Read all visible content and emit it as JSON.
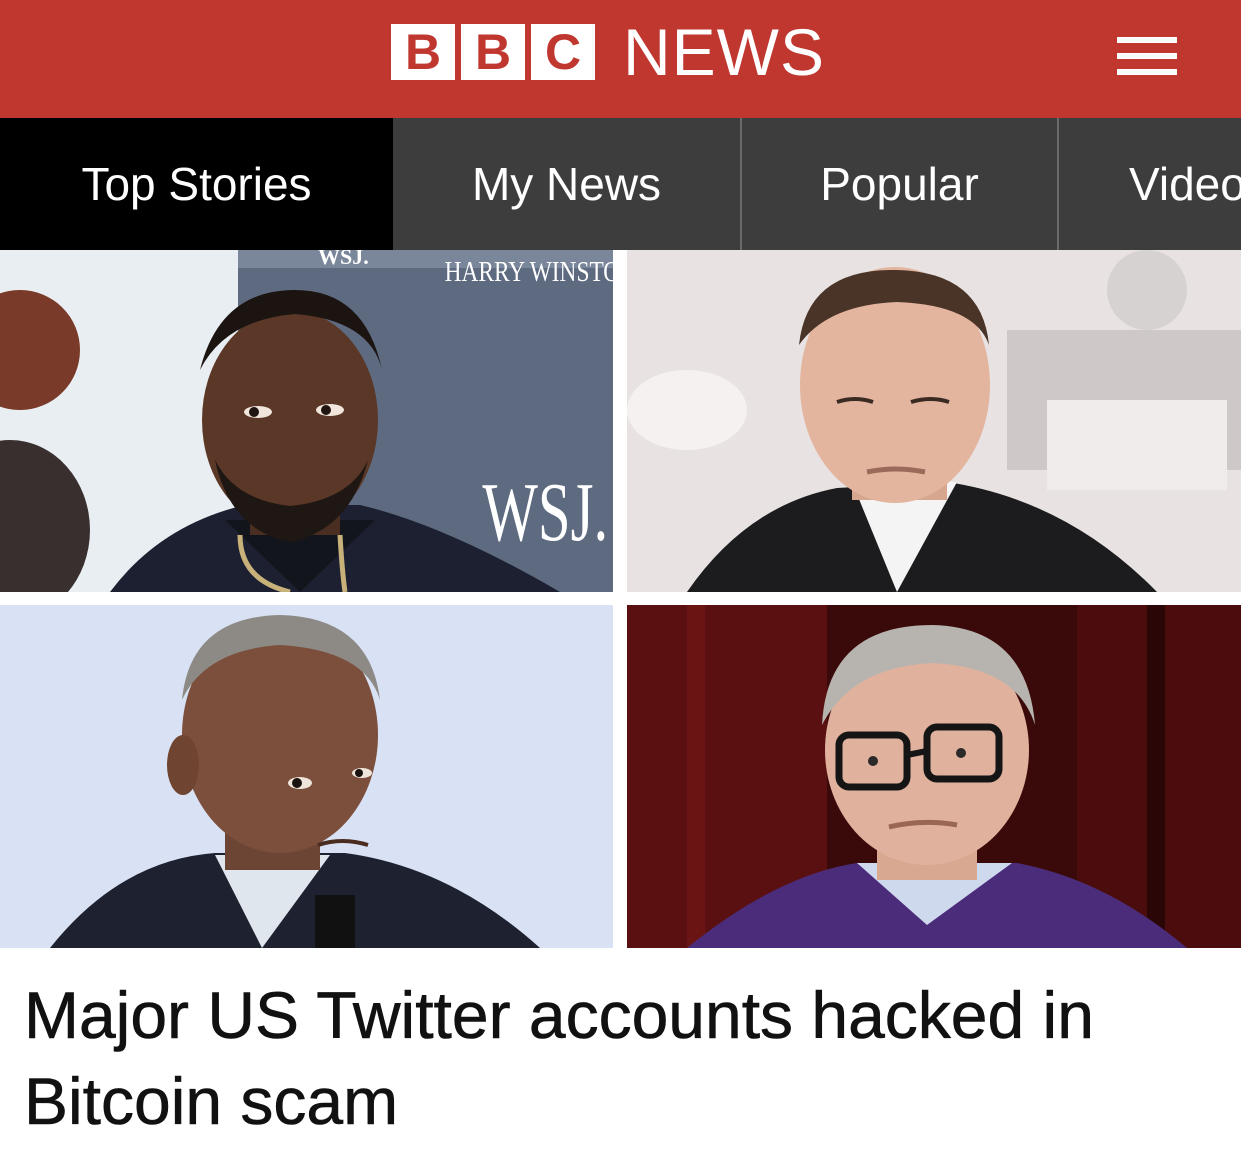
{
  "header": {
    "logo_letters": [
      "B",
      "B",
      "C"
    ],
    "logo_word": "NEWS",
    "menu_icon": "hamburger-menu-icon",
    "brand_color": "#c0372f"
  },
  "nav": {
    "tabs": [
      {
        "label": "Top Stories",
        "active": true
      },
      {
        "label": "My News",
        "active": false
      },
      {
        "label": "Popular",
        "active": false
      },
      {
        "label": "Video",
        "active": false
      }
    ]
  },
  "photos": {
    "top_left_signage": {
      "brand": "HARRY WINSTON",
      "logo": "WSJ.",
      "partial": "WSJ."
    },
    "top_right": {},
    "bottom_left": {},
    "bottom_right": {}
  },
  "article": {
    "headline": "Major US Twitter accounts hacked in Bitcoin scam"
  }
}
